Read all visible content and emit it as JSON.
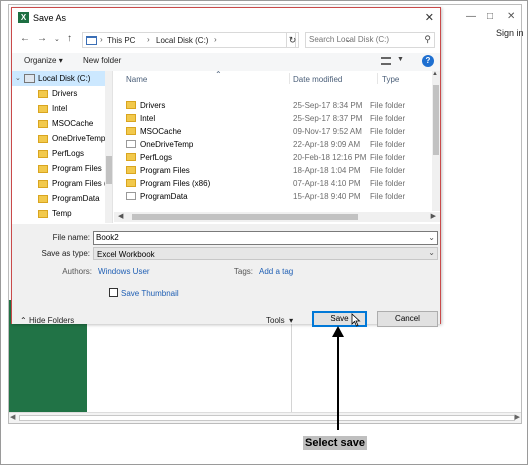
{
  "window": {
    "title": "Save As",
    "app_icon_letter": "X",
    "sign_in": "Sign in"
  },
  "address": {
    "crumbs": [
      "This PC",
      "Local Disk (C:)"
    ],
    "search_placeholder": "Search Local Disk (C:)"
  },
  "toolbar": {
    "organize": "Organize",
    "new_folder": "New folder",
    "help": "?"
  },
  "tree": {
    "items": [
      {
        "label": "Local Disk (C:)",
        "kind": "disk",
        "selected": true
      },
      {
        "label": "Drivers",
        "kind": "folder"
      },
      {
        "label": "Intel",
        "kind": "folder"
      },
      {
        "label": "MSOCache",
        "kind": "folder"
      },
      {
        "label": "OneDriveTemp",
        "kind": "folder"
      },
      {
        "label": "PerfLogs",
        "kind": "folder"
      },
      {
        "label": "Program Files",
        "kind": "folder"
      },
      {
        "label": "Program Files (",
        "kind": "folder"
      },
      {
        "label": "ProgramData",
        "kind": "folder"
      },
      {
        "label": "Temp",
        "kind": "folder"
      }
    ]
  },
  "columns": {
    "name": "Name",
    "date": "Date modified",
    "type": "Type"
  },
  "files": [
    {
      "name": "Drivers",
      "date": "25-Sep-17 8:34 PM",
      "type": "File folder"
    },
    {
      "name": "Intel",
      "date": "25-Sep-17 8:37 PM",
      "type": "File folder"
    },
    {
      "name": "MSOCache",
      "date": "09-Nov-17 9:52 AM",
      "type": "File folder"
    },
    {
      "name": "OneDriveTemp",
      "date": "22-Apr-18 9:09 AM",
      "type": "File folder"
    },
    {
      "name": "PerfLogs",
      "date": "20-Feb-18 12:16 PM",
      "type": "File folder"
    },
    {
      "name": "Program Files",
      "date": "18-Apr-18 1:04 PM",
      "type": "File folder"
    },
    {
      "name": "Program Files (x86)",
      "date": "07-Apr-18 4:10 PM",
      "type": "File folder"
    },
    {
      "name": "ProgramData",
      "date": "15-Apr-18 9:40 PM",
      "type": "File folder"
    }
  ],
  "form": {
    "file_name_label": "File name:",
    "file_name_value": "Book2",
    "save_type_label": "Save as type:",
    "save_type_value": "Excel Workbook",
    "authors_label": "Authors:",
    "authors_value": "Windows User",
    "tags_label": "Tags:",
    "tags_value": "Add a tag",
    "thumbnail_label": "Save Thumbnail",
    "hide_folders": "Hide Folders",
    "tools": "Tools",
    "save": "Save",
    "cancel": "Cancel"
  },
  "annotation": {
    "text": "Select save"
  }
}
